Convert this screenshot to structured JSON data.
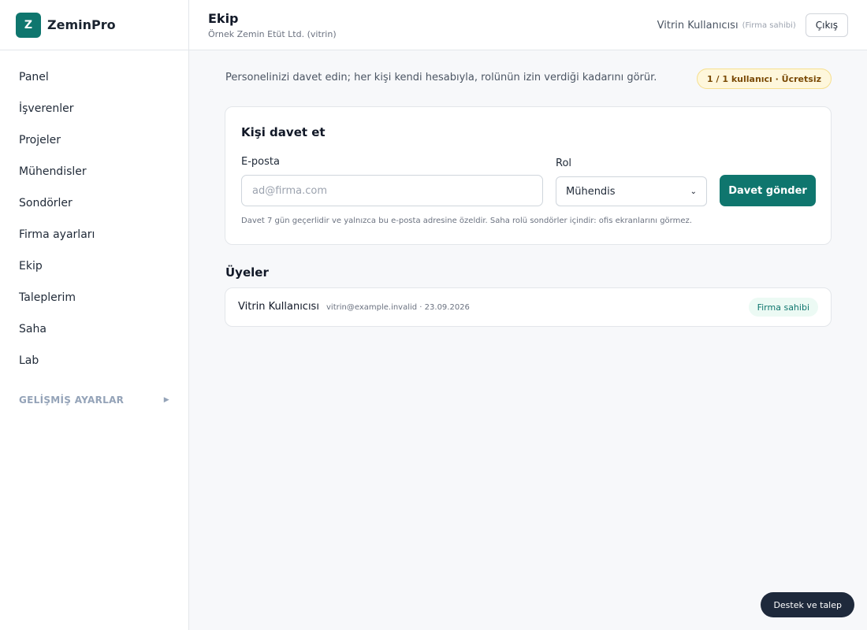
{
  "brand": {
    "logo_letter": "Z",
    "name": "ZeminPro",
    "color": "#0f766e"
  },
  "sidebar": {
    "items": [
      {
        "label": "Panel"
      },
      {
        "label": "İşverenler"
      },
      {
        "label": "Projeler"
      },
      {
        "label": "Mühendisler"
      },
      {
        "label": "Sondörler"
      },
      {
        "label": "Firma ayarları"
      },
      {
        "label": "Ekip"
      },
      {
        "label": "Taleplerim"
      },
      {
        "label": "Saha"
      },
      {
        "label": "Lab"
      }
    ],
    "advanced_label": "GELİŞMİŞ AYARLAR",
    "advanced_icon": "triangle-right-icon"
  },
  "header": {
    "title": "Ekip",
    "subtitle": "Örnek Zemin Etüt Ltd. (vitrin)",
    "user_name": "Vitrin Kullanıcısı",
    "user_role": "(Firma sahibi)",
    "logout_label": "Çıkış"
  },
  "main": {
    "intro": "Personelinizi davet edin; her kişi kendi hesabıyla, rolünün izin verdiği kadarını görür.",
    "quota_badge": "1 / 1 kullanıcı · Ücretsiz"
  },
  "invite": {
    "title": "Kişi davet et",
    "email_label": "E-posta",
    "email_placeholder": "ad@firma.com",
    "email_value": "",
    "role_label": "Rol",
    "role_value": "Mühendis",
    "submit_label": "Davet gönder",
    "hint": "Davet 7 gün geçerlidir ve yalnızca bu e-posta adresine özeldir. Saha rolü sondörler içindir: ofis ekranlarını görmez."
  },
  "members": {
    "title": "Üyeler",
    "rows": [
      {
        "name": "Vitrin Kullanıcısı",
        "meta": "vitrin@example.invalid · 23.09.2026",
        "role": "Firma sahibi"
      }
    ]
  },
  "support_label": "Destek ve talep"
}
